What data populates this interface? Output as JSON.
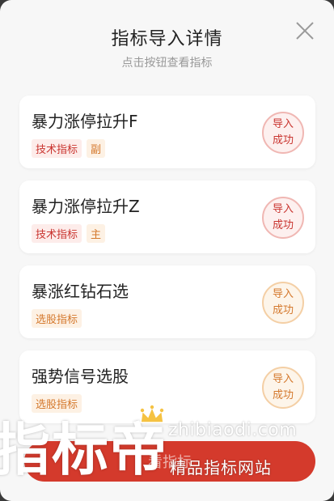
{
  "dialog": {
    "title": "指标导入详情",
    "subtitle": "点击按钮查看指标"
  },
  "items": [
    {
      "name": "暴力涨停拉升F",
      "tags": [
        "技术指标",
        "副"
      ],
      "status_line1": "导入",
      "status_line2": "成功",
      "tone": "red"
    },
    {
      "name": "暴力涨停拉升Z",
      "tags": [
        "技术指标",
        "主"
      ],
      "status_line1": "导入",
      "status_line2": "成功",
      "tone": "red"
    },
    {
      "name": "暴涨红钻石选",
      "tags": [
        "选股指标"
      ],
      "status_line1": "导入",
      "status_line2": "成功",
      "tone": "orange"
    },
    {
      "name": "强势信号选股",
      "tags": [
        "选股指标"
      ],
      "status_line1": "导入",
      "status_line2": "成功",
      "tone": "orange"
    }
  ],
  "bottom_button": {
    "label": "看指标"
  },
  "watermark": {
    "big": "指标帝",
    "url": "zhibiaodi.com",
    "slogan": "精品指标网站"
  },
  "colors": {
    "accent_red": "#d43a2c",
    "tag_red": "#c9342f",
    "tag_orange": "#d4782c"
  },
  "icons": {
    "close": "close-icon",
    "crown": "crown-icon"
  }
}
